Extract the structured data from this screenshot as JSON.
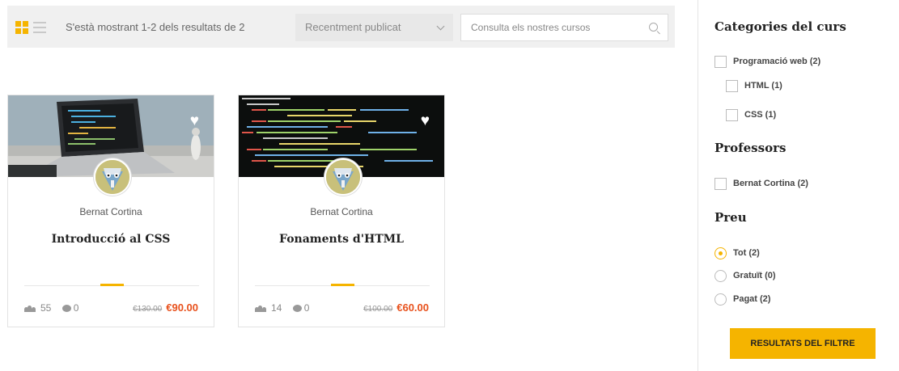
{
  "toolbar": {
    "grid_view_icon": "grid-icon",
    "list_view_icon": "list-icon",
    "result_count": "S'està mostrant 1-2 dels resultats de 2",
    "sort_value": "Recentment publicat",
    "search_placeholder": "Consulta els nostres cursos"
  },
  "courses": [
    {
      "teacher": "Bernat Cortina",
      "title": "Introducció al CSS",
      "students": "55",
      "comments": "0",
      "old_price": "€130.00",
      "price": "€90.00"
    },
    {
      "teacher": "Bernat Cortina",
      "title": "Fonaments d'HTML",
      "students": "14",
      "comments": "0",
      "old_price": "€100.00",
      "price": "€60.00"
    }
  ],
  "sidebar": {
    "categories_heading": "Categories del curs",
    "categories": [
      {
        "label": "Programació web (2)",
        "checked": false
      },
      {
        "label": "HTML (1)",
        "checked": false
      },
      {
        "label": "CSS (1)",
        "checked": false
      }
    ],
    "teachers_heading": "Professors",
    "teachers": [
      {
        "label": "Bernat Cortina (2)",
        "checked": false
      }
    ],
    "price_heading": "Preu",
    "prices": [
      {
        "label": "Tot (2)",
        "selected": true
      },
      {
        "label": "Gratuït (0)",
        "selected": false
      },
      {
        "label": "Pagat (2)",
        "selected": false
      }
    ],
    "filter_button": "RESULTATS DEL FILTRE"
  },
  "colors": {
    "accent": "#f5b400",
    "sale_price": "#e8511c"
  }
}
